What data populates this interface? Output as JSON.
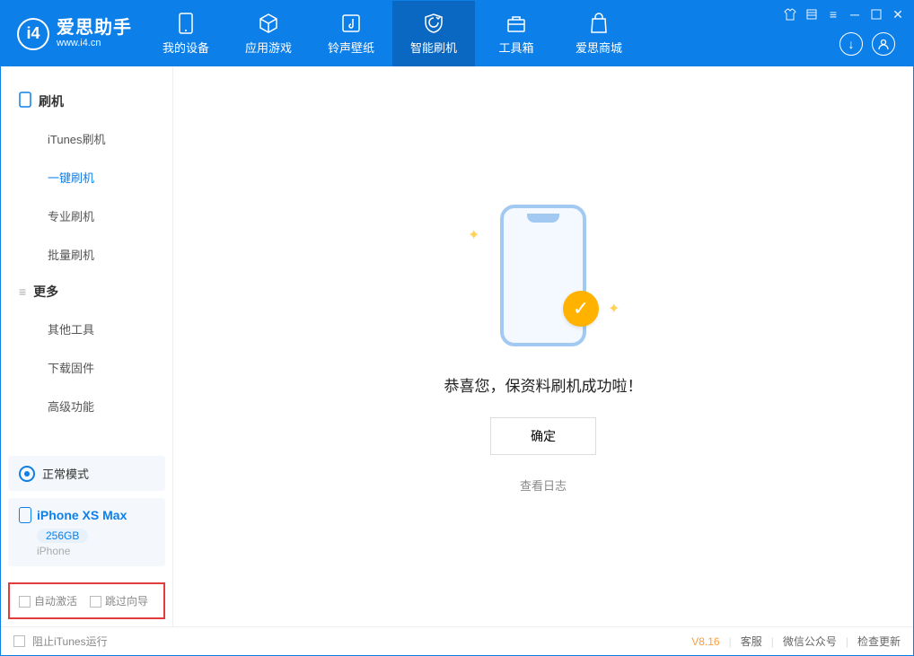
{
  "app": {
    "name": "爱思助手",
    "url": "www.i4.cn"
  },
  "nav": {
    "my_device": "我的设备",
    "apps_games": "应用游戏",
    "ring_wall": "铃声壁纸",
    "smart_flash": "智能刷机",
    "toolbox": "工具箱",
    "store": "爱思商城"
  },
  "sidebar": {
    "flash_header": "刷机",
    "itunes": "iTunes刷机",
    "oneclick": "一键刷机",
    "pro": "专业刷机",
    "batch": "批量刷机",
    "more_header": "更多",
    "other_tools": "其他工具",
    "download_fw": "下载固件",
    "advanced": "高级功能"
  },
  "device": {
    "mode": "正常模式",
    "name": "iPhone XS Max",
    "storage": "256GB",
    "type": "iPhone"
  },
  "options": {
    "auto_activate": "自动激活",
    "skip_guide": "跳过向导"
  },
  "main": {
    "success": "恭喜您，保资料刷机成功啦！",
    "ok": "确定",
    "view_log": "查看日志"
  },
  "footer": {
    "block_itunes": "阻止iTunes运行",
    "version": "V8.16",
    "support": "客服",
    "wechat": "微信公众号",
    "update": "检查更新"
  }
}
